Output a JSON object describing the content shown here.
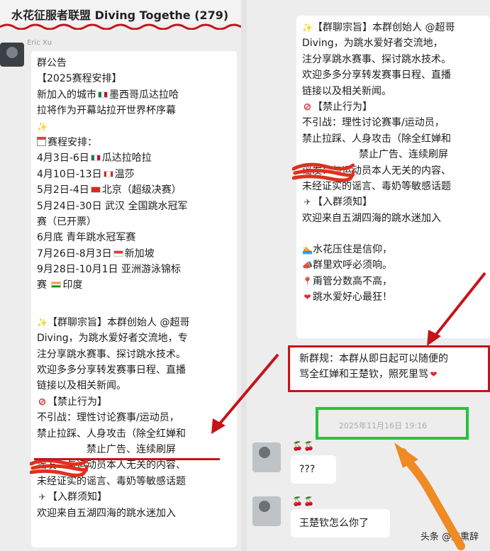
{
  "group_chat": {
    "title": "水花征服者联盟 Diving Togethe (279)",
    "sender_name": "Eric Xu"
  },
  "announcement": {
    "heading": "群公告",
    "schedule_title": "【2025赛程安排】",
    "new_city_line1": "新加入的城市",
    "new_city_line1_tail": "墨西哥瓜达拉哈",
    "new_city_line2": "拉将作为开幕站拉开世界杯序幕",
    "sparkle": "✨",
    "schedule_label": "赛程安排：",
    "schedule": [
      {
        "date": "4月3日-6日",
        "flag": "mx",
        "place": "瓜达拉哈拉"
      },
      {
        "date": "4月10日-13日",
        "flag": "ca",
        "place": "温莎"
      },
      {
        "date": "5月2日-4日",
        "flag": "cn",
        "place": "北京（超级决赛）"
      },
      {
        "date": "5月24日-30日",
        "flag": "",
        "place": "武汉 全国跳水冠军"
      },
      {
        "date": "",
        "flag": "",
        "place": "赛（已开票）"
      },
      {
        "date": "6月底",
        "flag": "",
        "place": "青年跳水冠军赛"
      },
      {
        "date": "7月26日-8月3日",
        "flag": "sg",
        "place": "新加坡"
      },
      {
        "date": "9月28日-10月1日",
        "flag": "",
        "place": "亚洲游泳锦标"
      },
      {
        "date": "",
        "flag": "in",
        "place": "赛 ",
        "place_tail": "印度"
      }
    ]
  },
  "purpose": {
    "left_lines": [
      "【群聊宗旨】本群创始人 @超哥",
      "Diving，为跳水爱好者交流地，专",
      "注分享跳水赛事、探讨跳水技术。",
      "欢迎多多分享转发赛事日程、直播",
      "链接以及相关新闻。"
    ],
    "right_lines": [
      "【群聊宗旨】本群创始人 @超哥",
      "Diving，为跳水爱好者交流地，",
      "注分享跳水赛事、探讨跳水技术。",
      "欢迎多多分享转发赛事日程、直播",
      "链接以及相关新闻。"
    ]
  },
  "prohibited": {
    "title": "【禁止行为】",
    "left_lines": [
      "不引战：理性讨论赛事/运动员，",
      "禁止拉踩、人身攻击（除全红婵和",
      "禁止广告、连续刷屏",
      "谣发：与运动员本人无关的内容、",
      "未经证实的谣言、毒奶等敏感话题"
    ],
    "right_lines": [
      "不引战：理性讨论赛事/运动员，",
      "禁止拉踩、人身攻击（除全红婵和",
      "禁止广告、连续刷屏",
      "谣发：与运动员本人无关的内容、",
      "未经证实的谣言、毒奶等敏感话题"
    ]
  },
  "join_notice": {
    "title": "【入群须知】",
    "welcome": "欢迎来自五湖四海的跳水迷加入"
  },
  "slogans": [
    {
      "icon": "pool",
      "text": "水花压住是信仰，"
    },
    {
      "icon": "horn",
      "text": "群里欢呼必须响。"
    },
    {
      "icon": "pin",
      "text": "甭管分数高不高，"
    },
    {
      "icon": "heart",
      "text": "跳水爱好心最狂！"
    }
  ],
  "new_rule": {
    "line1": "新群规：本群从即日起可以随便的",
    "line2": "骂全红婵和王楚钦，照死里骂"
  },
  "timestamp": "2025年11月16日 19:16",
  "messages": [
    {
      "reaction": "🍒🍒",
      "text": "???"
    },
    {
      "reaction": "🍒🍒",
      "text": "王楚钦怎么你了"
    }
  ],
  "watermark": "头条 @赫熏辞",
  "colors": {
    "highlight_red": "#c4141a",
    "highlight_green": "#27c13a",
    "bubble": "#ffffff",
    "background": "#ededed"
  }
}
